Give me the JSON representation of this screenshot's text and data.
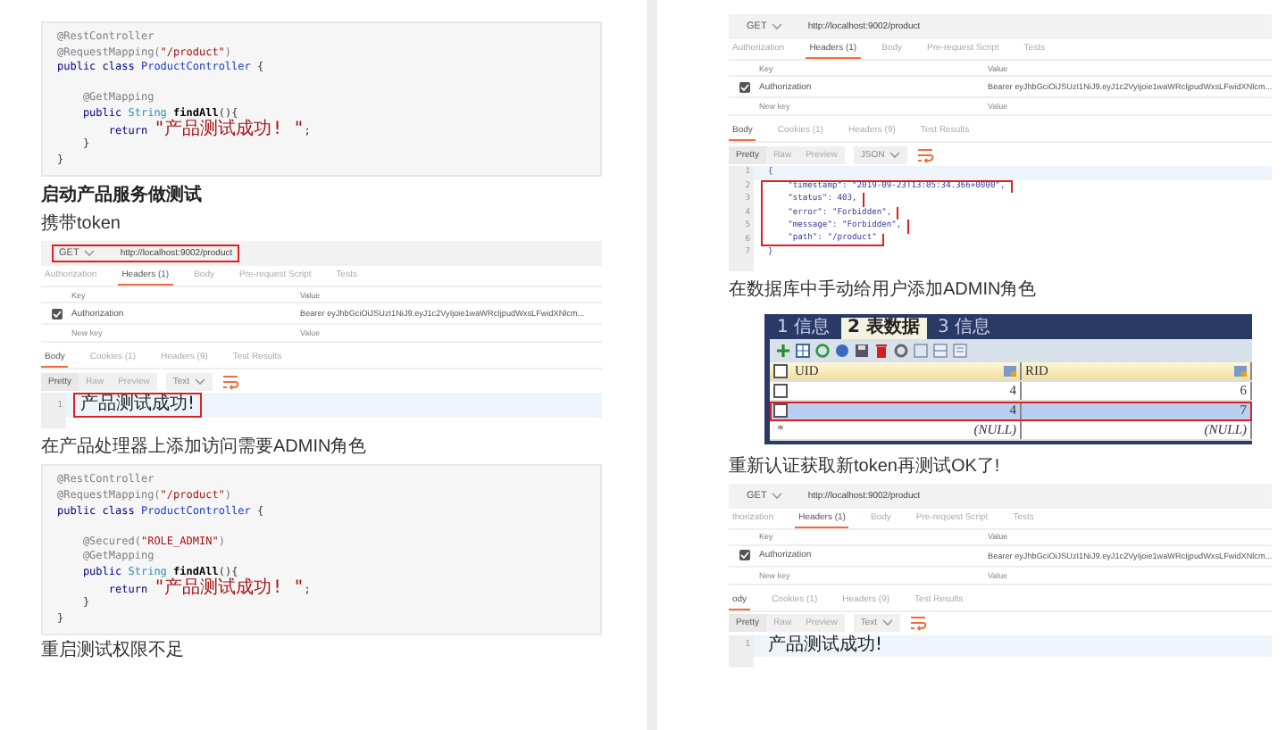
{
  "left_page": {
    "code_block_1": {
      "lines": [
        {
          "kind": "code",
          "tokens": [
            {
              "text": "@RestController",
              "kind": "annotation"
            }
          ]
        },
        {
          "kind": "code",
          "tokens": [
            {
              "text": "@RequestMapping(",
              "kind": "annotation"
            },
            {
              "text": "\"/product\"",
              "kind": "string"
            },
            {
              "text": ")",
              "kind": "annotation"
            }
          ]
        },
        {
          "kind": "code",
          "tokens": [
            {
              "text": "public class ",
              "kind": "keyword"
            },
            {
              "text": "ProductController",
              "kind": "classname"
            },
            {
              "text": " {",
              "kind": "plain"
            }
          ]
        },
        {
          "kind": "blank"
        },
        {
          "kind": "code",
          "tokens": [
            {
              "text": "    @GetMapping",
              "kind": "annotation"
            }
          ]
        },
        {
          "kind": "code",
          "tokens": [
            {
              "text": "    public ",
              "kind": "keyword"
            },
            {
              "text": "String",
              "kind": "type"
            },
            {
              "text": " findAll",
              "kind": "method"
            },
            {
              "text": "(){",
              "kind": "plain"
            }
          ]
        },
        {
          "kind": "code",
          "tokens": [
            {
              "text": "        return ",
              "kind": "keyword"
            },
            {
              "text": "\"产品测试成功! \"",
              "kind": "string"
            },
            {
              "text": ";",
              "kind": "plain"
            }
          ]
        },
        {
          "kind": "code",
          "tokens": [
            {
              "text": "    }",
              "kind": "plain"
            }
          ]
        },
        {
          "kind": "code",
          "tokens": [
            {
              "text": "}",
              "kind": "plain"
            }
          ]
        }
      ]
    },
    "heading": "启动产品服务做测试",
    "paragraph_1": "携带token",
    "postman_1": {
      "method": "GET",
      "url": "http://localhost:9002/product",
      "url_highlighted": true,
      "request_tabs": [
        {
          "label": "Authorization",
          "selected": false
        },
        {
          "label": "Headers (1)",
          "selected": true
        },
        {
          "label": "Body",
          "selected": false
        },
        {
          "label": "Pre-request Script",
          "selected": false
        },
        {
          "label": "Tests",
          "selected": false
        }
      ],
      "header_columns": [
        "Key",
        "Value"
      ],
      "headers": [
        {
          "key": "Authorization",
          "value": "Bearer eyJhbGciOiJSUzI1NiJ9.eyJ1c2VyIjoie1waWRcIjpudWxsLFwidXNlcm...",
          "checked": true
        }
      ],
      "key_placeholder": "New key",
      "value_placeholder": "Value",
      "response_tabs": [
        {
          "label": "Body",
          "selected": true
        },
        {
          "label": "Cookies (1)",
          "selected": false
        },
        {
          "label": "Headers (9)",
          "selected": false
        },
        {
          "label": "Test Results",
          "selected": false
        }
      ],
      "view_modes": [
        {
          "label": "Pretty",
          "selected": true
        },
        {
          "label": "Raw",
          "selected": false
        },
        {
          "label": "Preview",
          "selected": false
        }
      ],
      "format": "Text",
      "response_lines": [
        {
          "number": "1",
          "text": "产品测试成功!",
          "highlighted": true
        }
      ]
    },
    "paragraph_2": "在产品处理器上添加访问需要ADMIN角色",
    "code_block_2": {
      "lines": [
        {
          "kind": "code",
          "tokens": [
            {
              "text": "@RestController",
              "kind": "annotation"
            }
          ]
        },
        {
          "kind": "code",
          "tokens": [
            {
              "text": "@RequestMapping(",
              "kind": "annotation"
            },
            {
              "text": "\"/product\"",
              "kind": "string"
            },
            {
              "text": ")",
              "kind": "annotation"
            }
          ]
        },
        {
          "kind": "code",
          "tokens": [
            {
              "text": "public class ",
              "kind": "keyword"
            },
            {
              "text": "ProductController",
              "kind": "classname"
            },
            {
              "text": " {",
              "kind": "plain"
            }
          ]
        },
        {
          "kind": "blank"
        },
        {
          "kind": "code",
          "tokens": [
            {
              "text": "    @Secured(",
              "kind": "annotation"
            },
            {
              "text": "\"ROLE_ADMIN\"",
              "kind": "string"
            },
            {
              "text": ")",
              "kind": "annotation"
            }
          ]
        },
        {
          "kind": "code",
          "tokens": [
            {
              "text": "    @GetMapping",
              "kind": "annotation"
            }
          ]
        },
        {
          "kind": "code",
          "tokens": [
            {
              "text": "    public ",
              "kind": "keyword"
            },
            {
              "text": "String",
              "kind": "type"
            },
            {
              "text": " findAll",
              "kind": "method"
            },
            {
              "text": "(){",
              "kind": "plain"
            }
          ]
        },
        {
          "kind": "code",
          "tokens": [
            {
              "text": "        return ",
              "kind": "keyword"
            },
            {
              "text": "\"产品测试成功! \"",
              "kind": "string"
            },
            {
              "text": ";",
              "kind": "plain"
            }
          ]
        },
        {
          "kind": "code",
          "tokens": [
            {
              "text": "    }",
              "kind": "plain"
            }
          ]
        },
        {
          "kind": "code",
          "tokens": [
            {
              "text": "}",
              "kind": "plain"
            }
          ]
        }
      ]
    },
    "paragraph_3": "重启测试权限不足"
  },
  "right_page": {
    "postman_2": {
      "method": "GET",
      "url": "http://localhost:9002/product",
      "url_highlighted": false,
      "request_tabs": [
        {
          "label": "Authorization",
          "selected": false
        },
        {
          "label": "Headers (1)",
          "selected": true
        },
        {
          "label": "Body",
          "selected": false
        },
        {
          "label": "Pre-request Script",
          "selected": false
        },
        {
          "label": "Tests",
          "selected": false
        }
      ],
      "header_columns": [
        "Key",
        "Value"
      ],
      "headers": [
        {
          "key": "Authorization",
          "value": "Bearer eyJhbGciOiJSUzI1NiJ9.eyJ1c2VyIjoie1waWRcIjpudWxsLFwidXNlcm...",
          "checked": true
        }
      ],
      "key_placeholder": "New key",
      "value_placeholder": "Value",
      "response_tabs": [
        {
          "label": "Body",
          "selected": true
        },
        {
          "label": "Cookies (1)",
          "selected": false
        },
        {
          "label": "Headers (9)",
          "selected": false
        },
        {
          "label": "Test Results",
          "selected": false
        }
      ],
      "view_modes": [
        {
          "label": "Pretty",
          "selected": true
        },
        {
          "label": "Raw",
          "selected": false
        },
        {
          "label": "Preview",
          "selected": false
        }
      ],
      "format": "JSON",
      "response_lines": [
        {
          "number": "1",
          "text": "{",
          "highlighted": false
        },
        {
          "number": "2",
          "text": "    \"timestamp\": \"2019-09-23T13:05:34.366+0000\",",
          "highlighted": true
        },
        {
          "number": "3",
          "text": "    \"status\": 403,",
          "highlighted": true
        },
        {
          "number": "4",
          "text": "    \"error\": \"Forbidden\",",
          "highlighted": true
        },
        {
          "number": "5",
          "text": "    \"message\": \"Forbidden\",",
          "highlighted": true
        },
        {
          "number": "6",
          "text": "    \"path\": \"/product\"",
          "highlighted": true
        },
        {
          "number": "7",
          "text": "}",
          "highlighted": false
        }
      ]
    },
    "paragraph_4": "在数据库中手动给用户添加ADMIN角色",
    "db_grid": {
      "tabs": [
        {
          "label": "1 信息",
          "selected": false
        },
        {
          "label": "2 表数据",
          "selected": true
        },
        {
          "label": "3 信息",
          "selected": false
        }
      ],
      "header_checked": false,
      "columns": [
        "UID",
        "RID"
      ],
      "rows": [
        {
          "kind": "data",
          "cells": [
            "4",
            "6"
          ],
          "selected": false,
          "checked": false
        },
        {
          "kind": "data",
          "cells": [
            "4",
            "7"
          ],
          "selected": true,
          "checked": false
        },
        {
          "kind": "new",
          "marker": "*",
          "cells": [
            "(NULL)",
            "(NULL)"
          ],
          "selected": false
        }
      ]
    },
    "paragraph_5": "重新认证获取新token再测试OK了!",
    "postman_3": {
      "method": "GET",
      "url": "http://localhost:9002/product",
      "url_highlighted": false,
      "request_tabs": [
        {
          "label": "thorization",
          "selected": false
        },
        {
          "label": "Headers (1)",
          "selected": true
        },
        {
          "label": "Body",
          "selected": false
        },
        {
          "label": "Pre-request Script",
          "selected": false
        },
        {
          "label": "Tests",
          "selected": false
        }
      ],
      "header_columns": [
        "Key",
        "Value"
      ],
      "headers": [
        {
          "key": "Authorization",
          "value": "Bearer eyJhbGciOiJSUzI1NiJ9.eyJ1c2VyIjoie1waWRcIjpudWxsLFwidXNlcm...",
          "checked": true
        }
      ],
      "key_placeholder": "New key",
      "value_placeholder": "Value",
      "response_tabs": [
        {
          "label": "ody",
          "selected": true
        },
        {
          "label": "Cookies (1)",
          "selected": false
        },
        {
          "label": "Headers (9)",
          "selected": false
        },
        {
          "label": "Test Results",
          "selected": false
        }
      ],
      "view_modes": [
        {
          "label": "Pretty",
          "selected": true
        },
        {
          "label": "Raw",
          "selected": false
        },
        {
          "label": "Preview",
          "selected": false
        }
      ],
      "format": "Text",
      "response_lines": [
        {
          "number": "1",
          "text": "产品测试成功!",
          "highlighted": false
        }
      ]
    }
  }
}
